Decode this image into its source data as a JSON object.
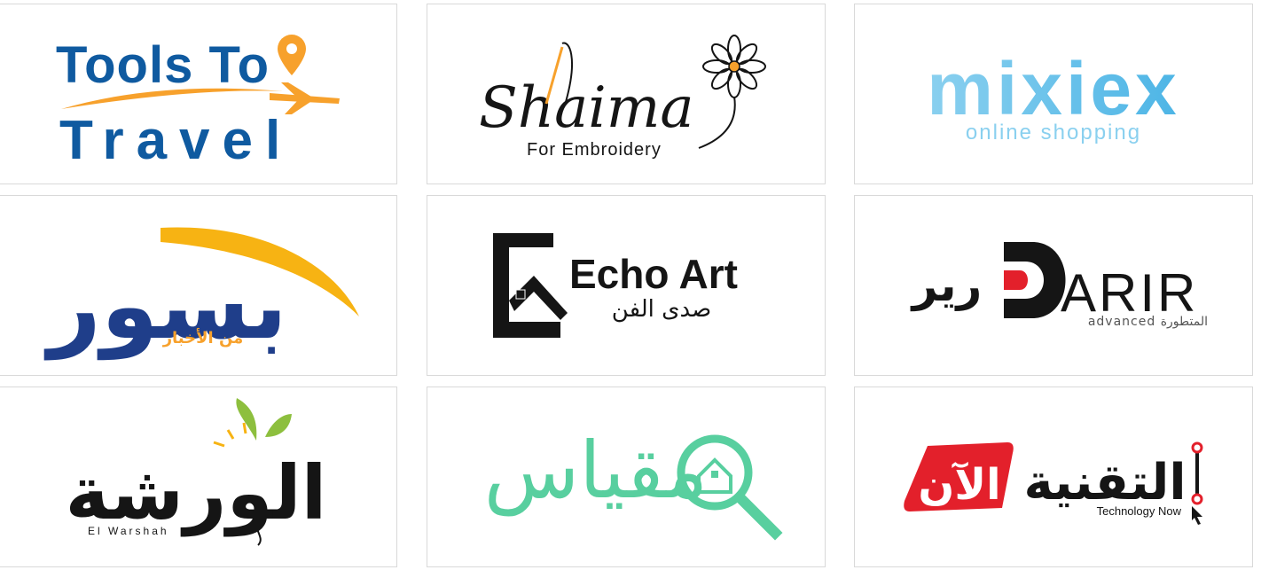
{
  "colors": {
    "navy": "#0f5aa0",
    "orange": "#f7a12c",
    "black": "#151515",
    "sky_light": "#8ad0ef",
    "sky": "#4db5e6",
    "mint": "#58cf9f",
    "red": "#e3202b",
    "green": "#8dbf3e",
    "border": "#d9d9d9"
  },
  "logos": [
    {
      "line1": "Tools To",
      "line2": "Travel"
    },
    {
      "name": "Shaima",
      "tagline": "For Embroidery"
    },
    {
      "name": "mixiex",
      "tagline": "online shopping"
    },
    {
      "name": "بسور",
      "tagline": "من الأخبار"
    },
    {
      "name": "Echo Art",
      "tagline": "صدى الفن"
    },
    {
      "name": "ARIR",
      "arabic": "رير",
      "tagline": "advanced المتطورة"
    },
    {
      "name": "الورشة",
      "tagline": "El Warshah"
    },
    {
      "name": "مقياس"
    },
    {
      "name": "التقنية",
      "badge": "الآن",
      "tagline": "Technology Now"
    }
  ]
}
